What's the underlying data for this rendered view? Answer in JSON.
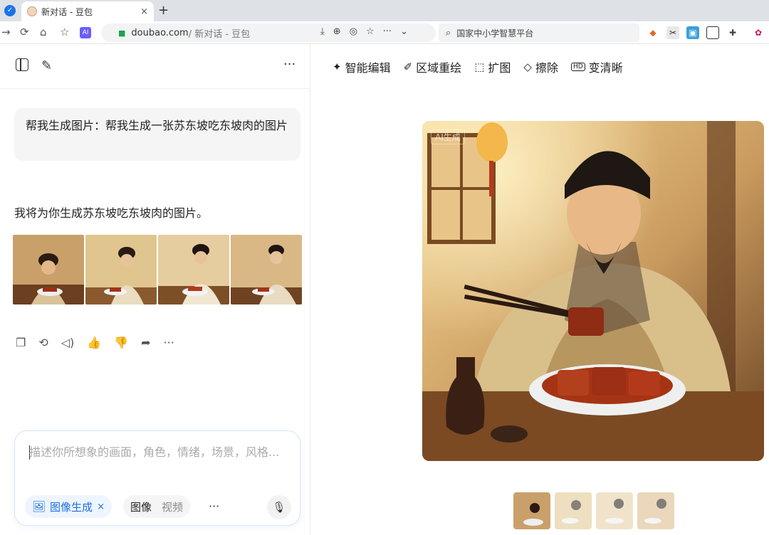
{
  "browser": {
    "tab_title": "新对话 - 豆包",
    "tab_close": "×",
    "new_tab": "+",
    "url_domain": "doubao.com",
    "url_path": " / 新对话 - 豆包",
    "search_text": "国家中小学智慧平台"
  },
  "sidebar": {
    "user_message": "帮我生成图片：帮我生成一张苏东坡吃东坡肉的图片",
    "assistant_reply": "我将为你生成苏东坡吃东坡肉的图片。",
    "input_placeholder": "描述你所想象的画面，角色，情绪，场景，风格...",
    "chip_label": "图像生成",
    "chip_close": "×",
    "mode_image": "图像",
    "mode_video": "视频",
    "more_label": "···",
    "top_more": "···"
  },
  "editor": {
    "tools": [
      {
        "label": "智能编辑",
        "icon": "magic-wand-icon"
      },
      {
        "label": "区域重绘",
        "icon": "brush-icon"
      },
      {
        "label": "扩图",
        "icon": "expand-icon"
      },
      {
        "label": "擦除",
        "icon": "eraser-icon"
      },
      {
        "label": "变清晰",
        "icon": "hd-icon"
      }
    ],
    "ai_watermark": "AI生成"
  },
  "colors": {
    "accent": "#1d6fe0",
    "chip_bg": "#eef5ff"
  }
}
